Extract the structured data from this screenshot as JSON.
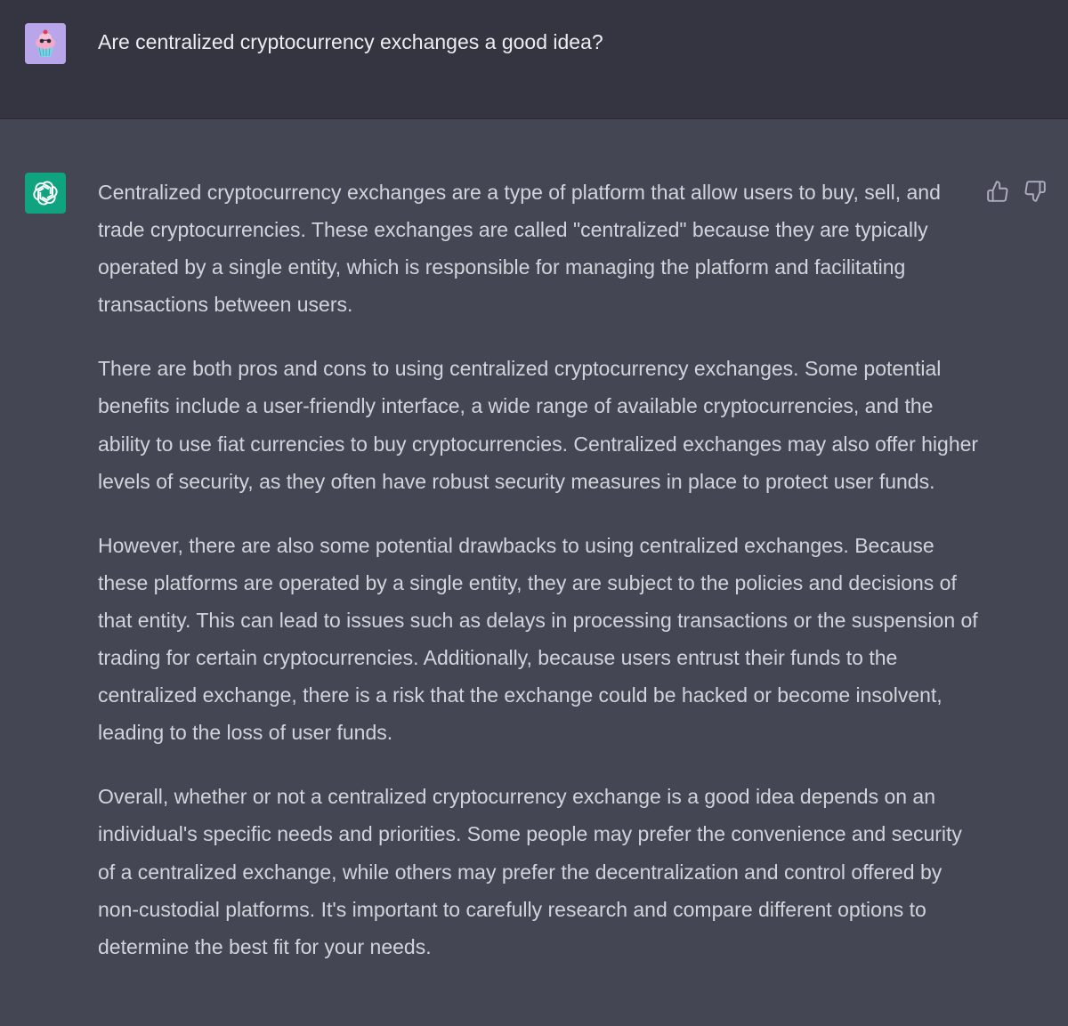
{
  "conversation": {
    "user_message": {
      "avatar_icon": "cupcake-avatar-icon",
      "text": "Are centralized cryptocurrency exchanges a good idea?"
    },
    "assistant_message": {
      "avatar_icon": "openai-logo-icon",
      "paragraphs": [
        "Centralized cryptocurrency exchanges are a type of platform that allow users to buy, sell, and trade cryptocurrencies. These exchanges are called \"centralized\" because they are typically operated by a single entity, which is responsible for managing the platform and facilitating transactions between users.",
        "There are both pros and cons to using centralized cryptocurrency exchanges. Some potential benefits include a user-friendly interface, a wide range of available cryptocurrencies, and the ability to use fiat currencies to buy cryptocurrencies. Centralized exchanges may also offer higher levels of security, as they often have robust security measures in place to protect user funds.",
        "However, there are also some potential drawbacks to using centralized exchanges. Because these platforms are operated by a single entity, they are subject to the policies and decisions of that entity. This can lead to issues such as delays in processing transactions or the suspension of trading for certain cryptocurrencies. Additionally, because users entrust their funds to the centralized exchange, there is a risk that the exchange could be hacked or become insolvent, leading to the loss of user funds.",
        "Overall, whether or not a centralized cryptocurrency exchange is a good idea depends on an individual's specific needs and priorities. Some people may prefer the convenience and security of a centralized exchange, while others may prefer the decentralization and control offered by non-custodial platforms. It's important to carefully research and compare different options to determine the best fit for your needs."
      ],
      "feedback": {
        "thumbs_up_icon": "thumbs-up-icon",
        "thumbs_down_icon": "thumbs-down-icon"
      }
    }
  },
  "colors": {
    "user_row_bg": "#343541",
    "assistant_row_bg": "#444654",
    "assistant_avatar_bg": "#10a37f",
    "text": "#d1d5db"
  }
}
